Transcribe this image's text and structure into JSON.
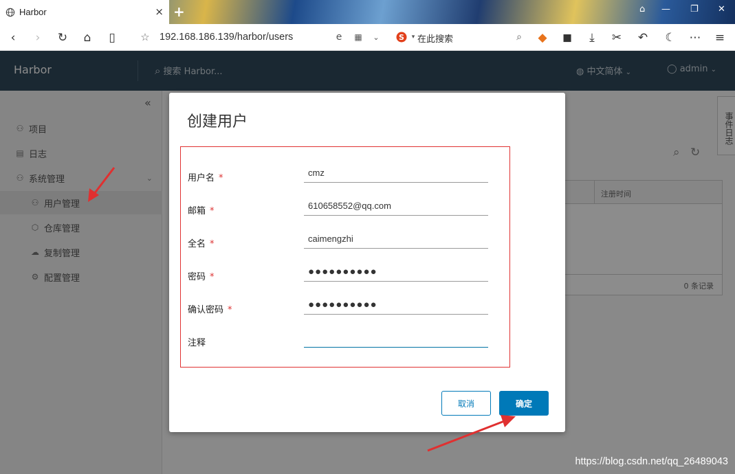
{
  "browser": {
    "tab_title": "Harbor",
    "tab_close": "×",
    "new_tab": "+",
    "url": "192.168.186.139/harbor/users",
    "search_engine_placeholder": "在此搜索"
  },
  "app": {
    "brand": "Harbor",
    "search_placeholder": "搜索 Harbor...",
    "language": "中文简体",
    "user": "admin"
  },
  "sidebar": {
    "collapse_icon": "«",
    "items": [
      {
        "label": "项目",
        "icon": "project-icon"
      },
      {
        "label": "日志",
        "icon": "log-icon"
      },
      {
        "label": "系统管理",
        "icon": "admin-icon"
      },
      {
        "label": "用户管理",
        "icon": "users-icon"
      },
      {
        "label": "仓库管理",
        "icon": "registry-icon"
      },
      {
        "label": "复制管理",
        "icon": "replication-icon"
      },
      {
        "label": "配置管理",
        "icon": "config-icon"
      }
    ]
  },
  "background_grid": {
    "column": "注册时间",
    "count": "0 条记录",
    "event_log_tab": "事件日志"
  },
  "modal": {
    "title": "创建用户",
    "fields": {
      "username": {
        "label": "用户名",
        "value": "cmz",
        "required": "*"
      },
      "email": {
        "label": "邮箱",
        "value": "610658552@qq.com",
        "required": "*"
      },
      "fullname": {
        "label": "全名",
        "value": "caimengzhi",
        "required": "*"
      },
      "password": {
        "label": "密码",
        "value": "●●●●●●●●●●",
        "required": "*"
      },
      "confirm_password": {
        "label": "确认密码",
        "value": "●●●●●●●●●●",
        "required": "*"
      },
      "comment": {
        "label": "注释",
        "value": ""
      }
    },
    "cancel_label": "取消",
    "ok_label": "确定"
  },
  "colors": {
    "header": "#314a5c",
    "primary": "#0079b8",
    "annotation_red": "#e03030"
  },
  "watermark": "https://blog.csdn.net/qq_26489043"
}
